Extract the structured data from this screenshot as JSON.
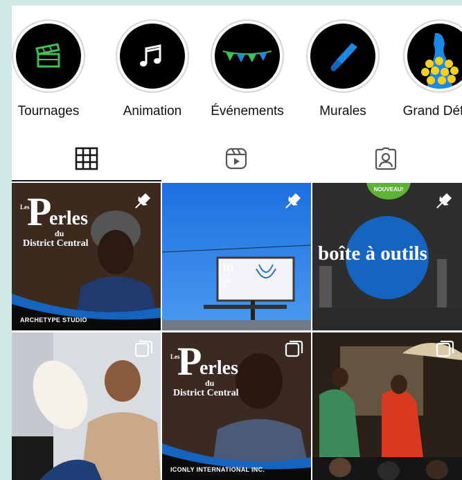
{
  "highlights": [
    {
      "label": "Tournages",
      "icon": "clapperboard-icon"
    },
    {
      "label": "Animation",
      "icon": "music-notes-icon"
    },
    {
      "label": "Événements",
      "icon": "bunting-icon"
    },
    {
      "label": "Murales",
      "icon": "paintbrush-icon"
    },
    {
      "label": "Grand Défilé",
      "icon": "flower-dress-icon"
    }
  ],
  "tabs": [
    {
      "name": "posts-grid",
      "icon": "grid-icon",
      "active": true
    },
    {
      "name": "reels",
      "icon": "reels-icon",
      "active": false
    },
    {
      "name": "tagged",
      "icon": "tagged-user-icon",
      "active": false
    }
  ],
  "posts": [
    {
      "type": "pinned",
      "title_initial": "P",
      "title_rest": "erles",
      "title_les": "Les",
      "title_du": "du",
      "title_district": "District Central",
      "caption": "ARCHETYPE STUDIO"
    },
    {
      "type": "pinned",
      "billboard_main": "ici",
      "billboard_line1": "à 2",
      "billboard_line2": "pas",
      "billboard_line3": "du"
    },
    {
      "type": "pinned",
      "badge": "NOUVEAU!",
      "text": "boîte à outils"
    },
    {
      "type": "carousel"
    },
    {
      "type": "carousel",
      "title_initial": "P",
      "title_rest": "erles",
      "title_les": "Les",
      "title_du": "du",
      "title_district": "District Central",
      "caption": "ICONLY INTERNATIONAL INC."
    },
    {
      "type": "carousel"
    }
  ],
  "colors": {
    "page_bg": "#cfe8e6",
    "accent_blue": "#1565c0",
    "badge_green": "#5cb338",
    "highlight_green": "#3fbf5a"
  }
}
